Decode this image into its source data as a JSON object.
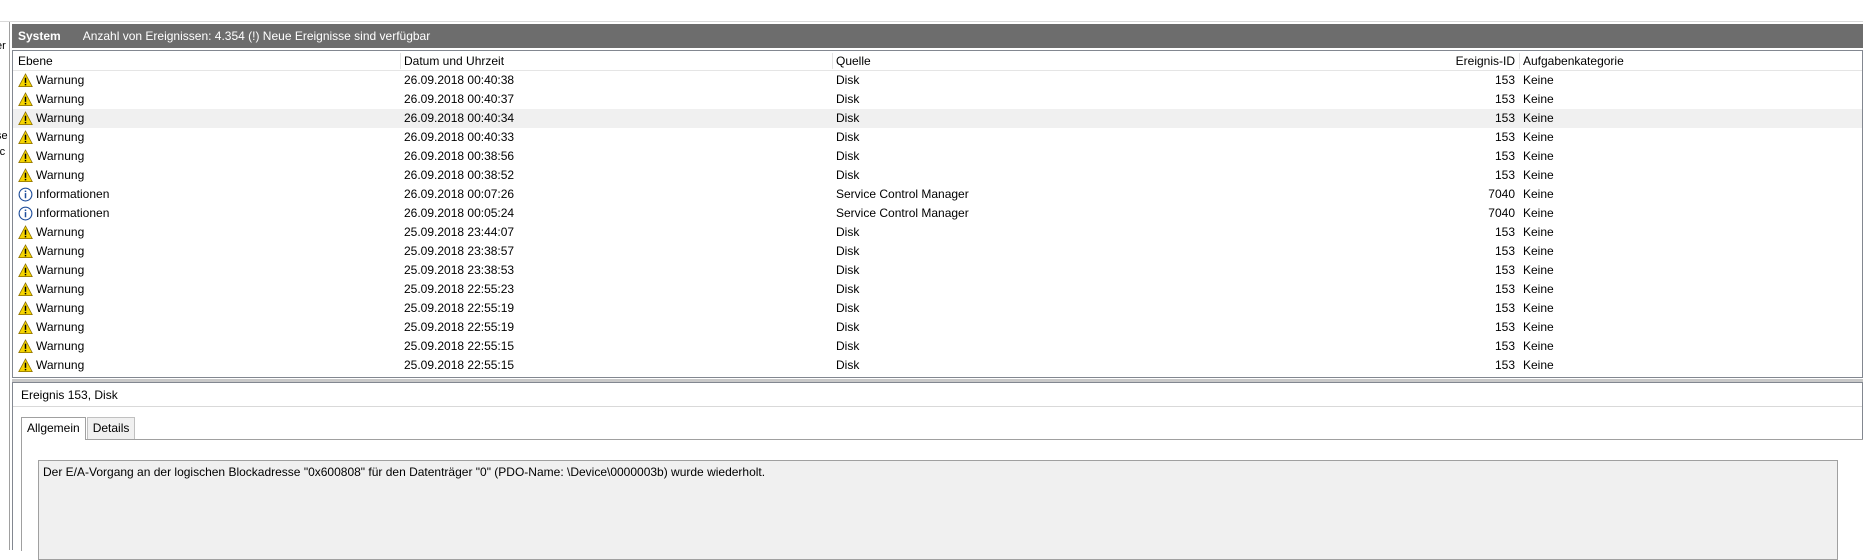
{
  "left_panel_fragments": [
    "er",
    "se",
    "rc"
  ],
  "titlebar": {
    "name": "System",
    "info": "Anzahl von Ereignissen: 4.354 (!) Neue Ereignisse sind verfügbar"
  },
  "table": {
    "columns": [
      "Ebene",
      "Datum und Uhrzeit",
      "Quelle",
      "Ereignis-ID",
      "Aufgabenkategorie"
    ],
    "rows": [
      {
        "level": "Warnung",
        "icon": "warning-icon",
        "datetime": "26.09.2018 00:40:38",
        "source": "Disk",
        "id": "153",
        "category": "Keine"
      },
      {
        "level": "Warnung",
        "icon": "warning-icon",
        "datetime": "26.09.2018 00:40:37",
        "source": "Disk",
        "id": "153",
        "category": "Keine"
      },
      {
        "level": "Warnung",
        "icon": "warning-icon",
        "datetime": "26.09.2018 00:40:34",
        "source": "Disk",
        "id": "153",
        "category": "Keine",
        "selected": true
      },
      {
        "level": "Warnung",
        "icon": "warning-icon",
        "datetime": "26.09.2018 00:40:33",
        "source": "Disk",
        "id": "153",
        "category": "Keine"
      },
      {
        "level": "Warnung",
        "icon": "warning-icon",
        "datetime": "26.09.2018 00:38:56",
        "source": "Disk",
        "id": "153",
        "category": "Keine"
      },
      {
        "level": "Warnung",
        "icon": "warning-icon",
        "datetime": "26.09.2018 00:38:52",
        "source": "Disk",
        "id": "153",
        "category": "Keine"
      },
      {
        "level": "Informationen",
        "icon": "info-icon",
        "datetime": "26.09.2018 00:07:26",
        "source": "Service Control Manager",
        "id": "7040",
        "category": "Keine"
      },
      {
        "level": "Informationen",
        "icon": "info-icon",
        "datetime": "26.09.2018 00:05:24",
        "source": "Service Control Manager",
        "id": "7040",
        "category": "Keine"
      },
      {
        "level": "Warnung",
        "icon": "warning-icon",
        "datetime": "25.09.2018 23:44:07",
        "source": "Disk",
        "id": "153",
        "category": "Keine"
      },
      {
        "level": "Warnung",
        "icon": "warning-icon",
        "datetime": "25.09.2018 23:38:57",
        "source": "Disk",
        "id": "153",
        "category": "Keine"
      },
      {
        "level": "Warnung",
        "icon": "warning-icon",
        "datetime": "25.09.2018 23:38:53",
        "source": "Disk",
        "id": "153",
        "category": "Keine"
      },
      {
        "level": "Warnung",
        "icon": "warning-icon",
        "datetime": "25.09.2018 22:55:23",
        "source": "Disk",
        "id": "153",
        "category": "Keine"
      },
      {
        "level": "Warnung",
        "icon": "warning-icon",
        "datetime": "25.09.2018 22:55:19",
        "source": "Disk",
        "id": "153",
        "category": "Keine"
      },
      {
        "level": "Warnung",
        "icon": "warning-icon",
        "datetime": "25.09.2018 22:55:19",
        "source": "Disk",
        "id": "153",
        "category": "Keine"
      },
      {
        "level": "Warnung",
        "icon": "warning-icon",
        "datetime": "25.09.2018 22:55:15",
        "source": "Disk",
        "id": "153",
        "category": "Keine"
      },
      {
        "level": "Warnung",
        "icon": "warning-icon",
        "datetime": "25.09.2018 22:55:15",
        "source": "Disk",
        "id": "153",
        "category": "Keine"
      }
    ]
  },
  "detail": {
    "title": "Ereignis 153, Disk",
    "tabs": [
      "Allgemein",
      "Details"
    ],
    "active_tab": "Allgemein",
    "message": "Der E/A-Vorgang an der logischen Blockadresse \"0x600808\" für den Datenträger \"0\" (PDO-Name: \\Device\\0000003b) wurde wiederholt."
  },
  "colors": {
    "titlebar_bg": "#6d6d6d",
    "selected_row_bg": "#f0f0f0",
    "warning_yellow": "#f5d400",
    "info_blue": "#1f4e9c"
  }
}
